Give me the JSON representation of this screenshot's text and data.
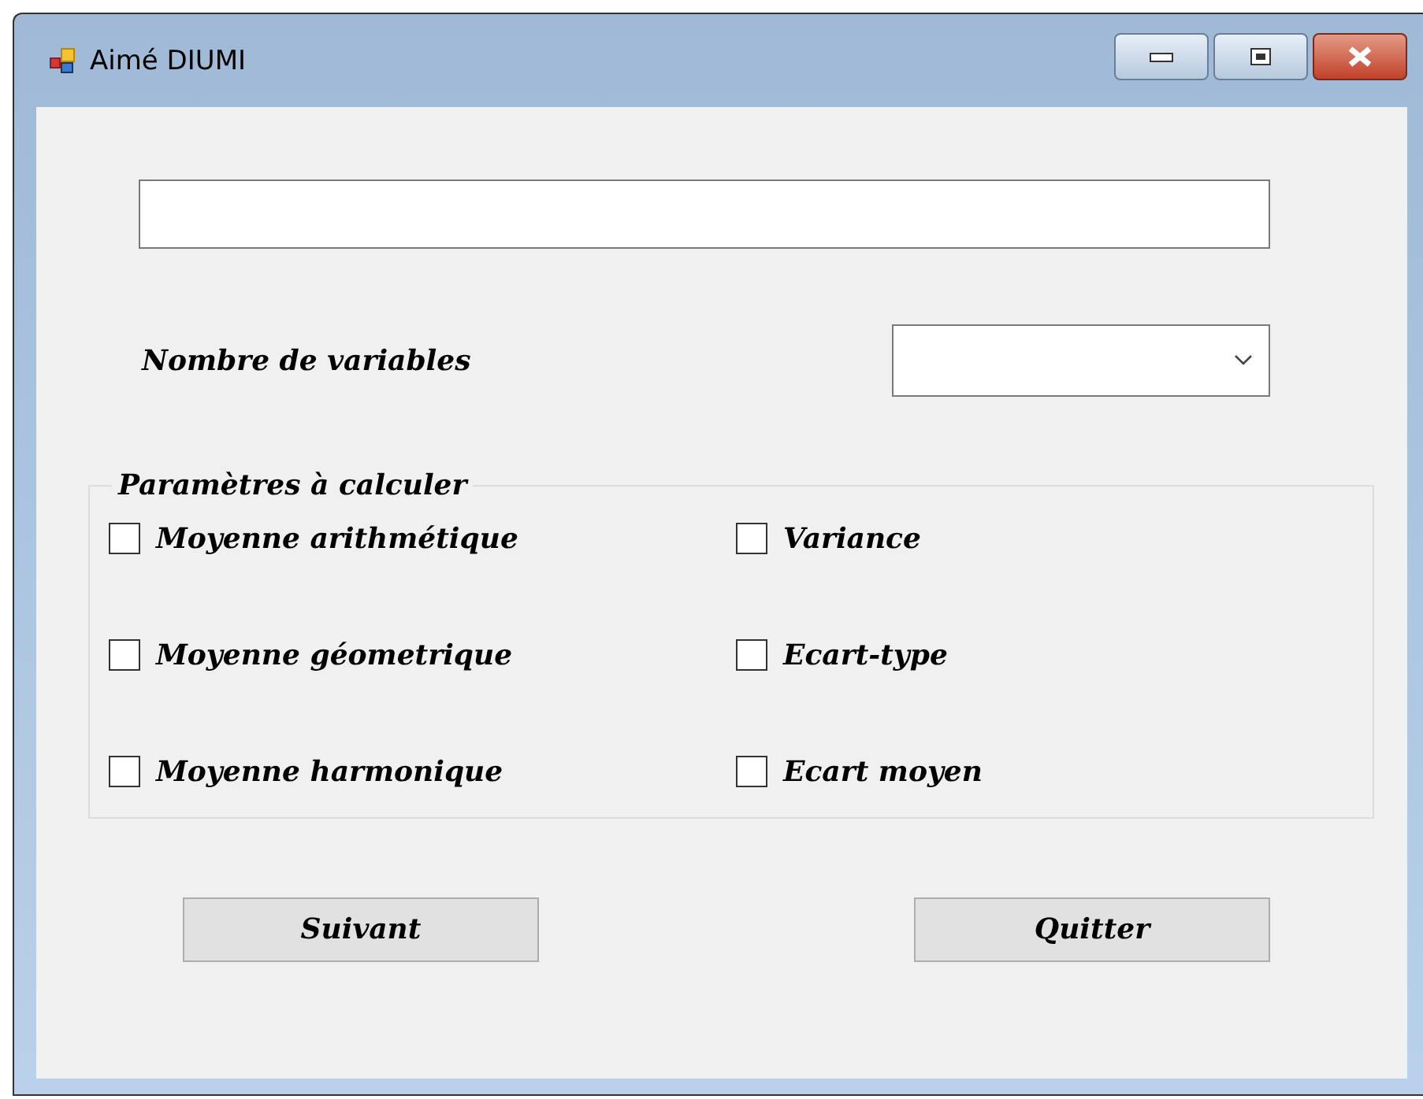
{
  "window": {
    "title": "Aimé DIUMI"
  },
  "variables": {
    "label": "Nombre de variables"
  },
  "group": {
    "legend": "Paramètres à calculer",
    "options": [
      {
        "label": "Moyenne arithmétique",
        "checked": false
      },
      {
        "label": "Variance",
        "checked": false
      },
      {
        "label": "Moyenne géometrique",
        "checked": false
      },
      {
        "label": "Ecart-type",
        "checked": false
      },
      {
        "label": "Moyenne harmonique",
        "checked": false
      },
      {
        "label": "Ecart moyen",
        "checked": false
      }
    ]
  },
  "buttons": [
    "Suivant",
    "Quitter"
  ]
}
